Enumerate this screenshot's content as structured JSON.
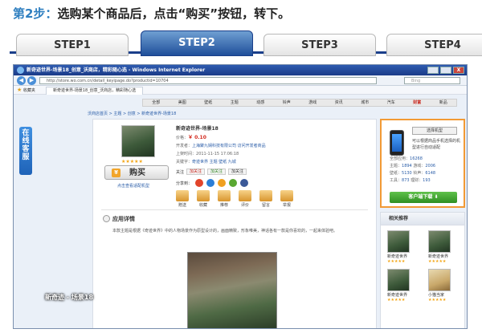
{
  "heading": {
    "step": "第2步：",
    "text": "选购某个商品后，点击“购买”按钮，转下。"
  },
  "steps": [
    "STEP1",
    "STEP2",
    "STEP3",
    "STEP4"
  ],
  "browser": {
    "title": "新奇迹世界-场景18_创意_沃商店，精彩随心选 - Windows Internet Explorer",
    "address": "http://store.wo.com.cn/detail_keyipage.do?productid=10704",
    "search_placeholder": "Bing",
    "favorites_label": "收藏夹",
    "tab_label": "新奇迹世界-场景18_创意_沃商店，精彩随心选",
    "close_label": "X"
  },
  "page": {
    "categories": [
      "全部",
      "美图",
      "壁纸",
      "主题",
      "动感",
      "铃声",
      "游戏",
      "资讯",
      "城市",
      "汽车",
      "财富",
      "新品"
    ],
    "breadcrumb": "沃商店首页 > 主题 > 创意 > 新奇迹世界-场景18",
    "left_tab": "在线客服",
    "product": {
      "title": "新奇迹世界-场景18",
      "stars": "★★★★★",
      "buy_label": "购买",
      "compat_link": "点击查看适配机型",
      "price_label": "价格：",
      "price": "￥ 0.10",
      "developer_label": "开发者：",
      "developer": "上海聚九娴科技有限公司",
      "developer_link": "访问开发者商品",
      "date_label": "上架时间：",
      "date": "2011-11-15 17:06:18",
      "keywords_label": "关键字：",
      "keywords": "奇迹世界 主题 壁纸 九城",
      "share_label": "关注",
      "share_buttons": [
        "加关注",
        "加关注",
        "加关注"
      ],
      "social_label": "分享到：",
      "actions": [
        "赠送",
        "收藏",
        "推荐",
        "评价",
        "留言",
        "举报"
      ]
    },
    "detail": {
      "title": "应用详情",
      "description": "本款主题是根据《奇迹世界》中的人物场景作为原型设计的，画面精致，形象唯美，神话各有一款是你喜欢的，一起来体验吧。"
    },
    "promo": {
      "select_label": "选择机型",
      "text": "可以根据商品手机选择的机型进行自动适配",
      "stats": [
        {
          "label": "全部应用：",
          "value": "16268"
        },
        {
          "label": "主题：",
          "value": "1894",
          "label2": "游戏：",
          "value2": "2006"
        },
        {
          "label": "壁纸：",
          "value": "5130",
          "label2": "铃声：",
          "value2": "6148"
        },
        {
          "label": "工具：",
          "value": "873",
          "label2": "理财：",
          "value2": "193"
        }
      ],
      "download_label": "客户端下载"
    },
    "related": {
      "title": "相关推荐",
      "items": [
        {
          "name": "新奇迹世界",
          "stars": "★★★★★"
        },
        {
          "name": "新奇迹世界",
          "stars": "★★★★★"
        },
        {
          "name": "新奇迹世界",
          "stars": "★★★★★"
        },
        {
          "name": "小猫当家",
          "stars": "★★★★★"
        }
      ]
    }
  },
  "overlay_text": "新奇迹 - 场景18",
  "colors": {
    "heading_step": "#2f7fc0",
    "active_step": "#1f4f9a",
    "price": "#d3291d",
    "download": "#2f8f22",
    "promo_border": "#f29a35"
  }
}
